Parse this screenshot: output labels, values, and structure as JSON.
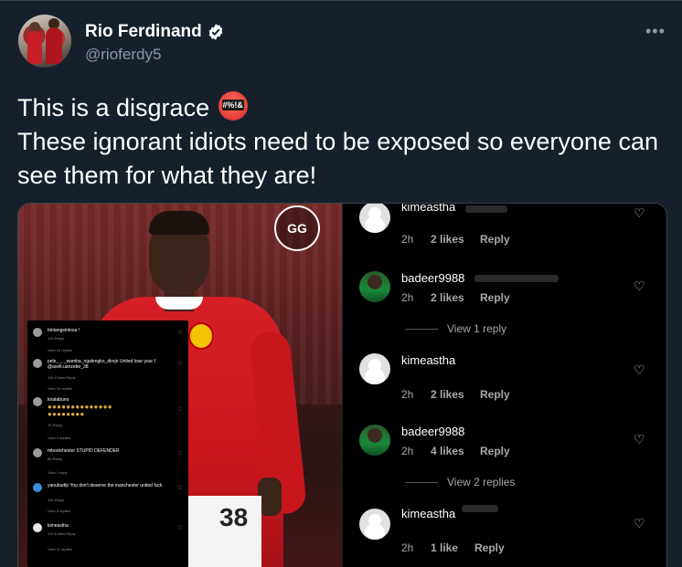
{
  "author": {
    "name": "Rio Ferdinand",
    "handle": "@rioferdy5",
    "more_label": "•••"
  },
  "tweet": {
    "line1": "This is a disgrace",
    "emoji_symbols": "#%!&",
    "line2": "These ignorant idiots need to be exposed so everyone can see them for what they are!"
  },
  "left_image": {
    "shirt_number": "38",
    "ig_comments": [
      {
        "user": "bintangsintosa !",
        "meta": "10h   Reply",
        "view": "View 24 replies"
      },
      {
        "user": "pele_ _ _wamba_ngalengko_direjo United lose your f   @axelt.uanzebe_38",
        "meta": "10h   2 likes   Reply",
        "view": "View 24 replies"
      },
      {
        "user": "kiratabuno",
        "meta": "7h   Reply",
        "view": "View 3 replies"
      },
      {
        "user": "mboolchester STUPID DEFENDER",
        "meta": "8h   Reply",
        "view": "View 1 reply"
      },
      {
        "user": "yanubudip You don't deserve the manchester united fuck",
        "meta": "10h   Reply",
        "view": "View 8 replies"
      },
      {
        "user": "kimeastha",
        "meta": "12h   6 likes   Reply",
        "view": "View 11 replies"
      }
    ]
  },
  "right_image": {
    "comments": [
      {
        "user": "kimeastha",
        "time": "2h",
        "likes": "2 likes",
        "reply": "Reply"
      },
      {
        "user": "badeer9988",
        "time": "2h",
        "likes": "2 likes",
        "reply": "Reply",
        "view": "View 1 reply"
      },
      {
        "user": "kimeastha",
        "time": "2h",
        "likes": "2 likes",
        "reply": "Reply"
      },
      {
        "user": "badeer9988",
        "time": "2h",
        "likes": "4 likes",
        "reply": "Reply",
        "view": "View 2 replies"
      },
      {
        "user": "kimeastha",
        "time": "2h",
        "likes": "1 like",
        "reply": "Reply"
      }
    ]
  }
}
